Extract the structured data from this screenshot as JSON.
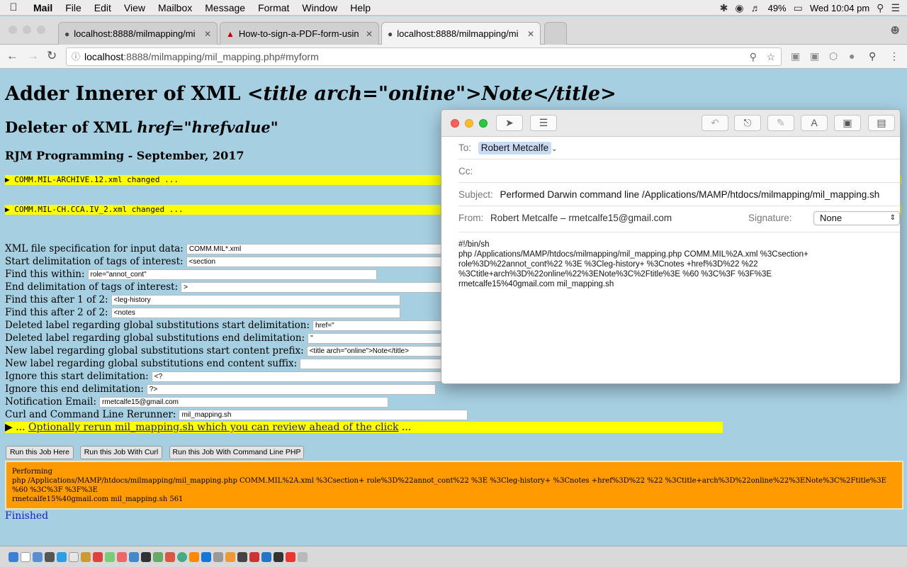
{
  "menubar": {
    "app_name": "Mail",
    "items": [
      "File",
      "Edit",
      "View",
      "Mailbox",
      "Message",
      "Format",
      "Window",
      "Help"
    ],
    "battery": "49%",
    "clock": "Wed 10:04 pm"
  },
  "browser": {
    "tabs": [
      {
        "title": "localhost:8888/milmapping/mi"
      },
      {
        "title": "How-to-sign-a-PDF-form-usin"
      },
      {
        "title": "localhost:8888/milmapping/mi"
      }
    ],
    "url_host": "localhost",
    "url_rest": ":8888/milmapping/mil_mapping.php#myform"
  },
  "page": {
    "h1_prefix": "Adder Innerer of XML ",
    "h1_code": "<title arch=\"online\">Note</title>",
    "h2_prefix": "Deleter of XML ",
    "h2_code": "href=\"hrefvalue\"",
    "h3": "RJM Programming - September, 2017",
    "changed_1": "▶ COMM.MIL-ARCHIVE.12.xml changed ...",
    "changed_2": "▶ COMM.MIL-CH.CCA.IV_2.xml changed ...",
    "fields": [
      {
        "label": "XML file specification for input data:",
        "value": "COMM.MIL*.xml"
      },
      {
        "label": "Start delimitation of tags of interest:",
        "value": "<section"
      },
      {
        "label": "Find this within:",
        "value": "role=\"annot_cont\""
      },
      {
        "label": "End delimitation of tags of interest:",
        "value": ">"
      },
      {
        "label": "Find this after 1 of 2:",
        "value": "<leg-history"
      },
      {
        "label": "Find this after 2 of 2:",
        "value": "<notes"
      },
      {
        "label": "Deleted label regarding global substitutions start delimitation:",
        "value": "href=\""
      },
      {
        "label": "Deleted label regarding global substitutions end delimitation:",
        "value": "\""
      },
      {
        "label": "New label regarding global substitutions start content prefix:",
        "value": "<title arch=\"online\">Note</title>"
      },
      {
        "label": "New label regarding global substitutions end content suffix:",
        "value": ""
      },
      {
        "label": "Ignore this start delimitation:",
        "value": "<?"
      },
      {
        "label": "Ignore this end delimitation:",
        "value": "?>"
      },
      {
        "label": "Notification Email:",
        "value": "rmetcalfe15@gmail.com"
      },
      {
        "label": "Curl and Command Line Rerunner:",
        "value": "mil_mapping.sh"
      }
    ],
    "rerun_prefix": "▶ ... ",
    "rerun_link": "Optionally rerun mil_mapping.sh which you can review ahead of the click",
    "rerun_suffix": " ...",
    "buttons": [
      "Run this Job Here",
      "Run this Job With Curl",
      "Run this Job With Command Line PHP"
    ],
    "output_line1": "Performing",
    "output_line2": "php /Applications/MAMP/htdocs/milmapping/mil_mapping.php COMM.MIL%2A.xml %3Csection+ role%3D%22annot_cont%22 %3E %3Cleg-history+ %3Cnotes +href%3D%22 %22 %3Ctitle+arch%3D%22online%22%3ENote%3C%2Ftitle%3E %60 %3C%3F %3F%3E",
    "output_line3": "rmetcalfe15%40gmail.com mil_mapping.sh 561",
    "finished": "Finished"
  },
  "mail": {
    "to_label": "To:",
    "to_value": "Robert Metcalfe",
    "cc_label": "Cc:",
    "subject_label": "Subject:",
    "subject_value": "Performed Darwin command line /Applications/MAMP/htdocs/milmapping/mil_mapping.sh",
    "from_label": "From:",
    "from_value": "Robert Metcalfe – rmetcalfe15@gmail.com",
    "signature_label": "Signature:",
    "signature_value": "None",
    "body": "#!/bin/sh\nphp /Applications/MAMP/htdocs/milmapping/mil_mapping.php COMM.MIL%2A.xml %3Csection+\nrole%3D%22annot_cont%22 %3E %3Cleg-history+ %3Cnotes +href%3D%22 %22\n%3Ctitle+arch%3D%22online%22%3ENote%3C%2Ftitle%3E %60 %3C%3F %3F%3E\nrmetcalfe15%40gmail.com mil_mapping.sh"
  },
  "colors": {
    "page_bg": "#a6d0e2",
    "highlight_yellow": "#ffff00",
    "output_orange": "#ff9a00",
    "finished_blue": "#1a1ad0",
    "recipient_chip": "#c9dcf5"
  },
  "icons": [
    "apple-icon",
    "wifi-icon",
    "bluetooth-icon",
    "volume-icon",
    "search-icon",
    "list-icon",
    "back-icon",
    "forward-icon",
    "reload-icon",
    "zoom-icon",
    "star-icon",
    "send-icon",
    "reply-icon",
    "attach-icon",
    "font-icon",
    "photo-icon",
    "template-icon"
  ]
}
